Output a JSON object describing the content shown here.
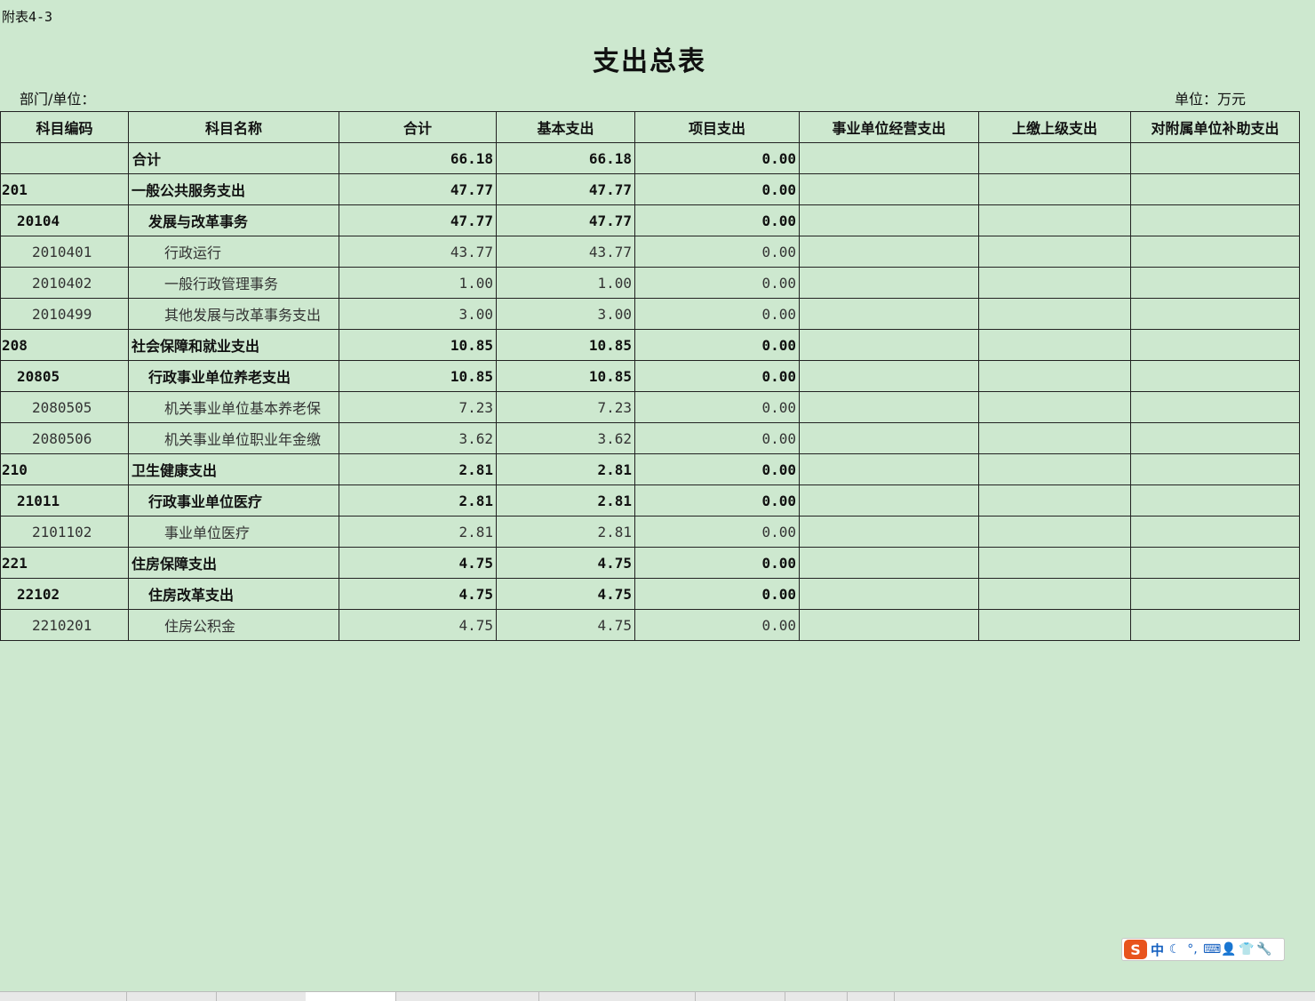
{
  "sheet": {
    "attach_label": "附表4-3",
    "title": "支出总表",
    "dept_label": "部门/单位：",
    "unit_label": "单位：万元"
  },
  "columns": [
    "科目编码",
    "科目名称",
    "合计",
    "基本支出",
    "项目支出",
    "事业单位经营支出",
    "上缴上级支出",
    "对附属单位补助支出"
  ],
  "rows": [
    {
      "code": "",
      "name": "合计",
      "total": "66.18",
      "basic": "66.18",
      "project": "0.00"
    },
    {
      "code": "201",
      "name": "一般公共服务支出",
      "total": "47.77",
      "basic": "47.77",
      "project": "0.00"
    },
    {
      "code": "20104",
      "name": "发展与改革事务",
      "total": "47.77",
      "basic": "47.77",
      "project": "0.00"
    },
    {
      "code": "2010401",
      "name": "行政运行",
      "total": "43.77",
      "basic": "43.77",
      "project": "0.00"
    },
    {
      "code": "2010402",
      "name": "一般行政管理事务",
      "total": "1.00",
      "basic": "1.00",
      "project": "0.00"
    },
    {
      "code": "2010499",
      "name": "其他发展与改革事务支出",
      "total": "3.00",
      "basic": "3.00",
      "project": "0.00"
    },
    {
      "code": "208",
      "name": "社会保障和就业支出",
      "total": "10.85",
      "basic": "10.85",
      "project": "0.00"
    },
    {
      "code": "20805",
      "name": "行政事业单位养老支出",
      "total": "10.85",
      "basic": "10.85",
      "project": "0.00"
    },
    {
      "code": "2080505",
      "name": "机关事业单位基本养老保",
      "total": "7.23",
      "basic": "7.23",
      "project": "0.00"
    },
    {
      "code": "2080506",
      "name": "机关事业单位职业年金缴",
      "total": "3.62",
      "basic": "3.62",
      "project": "0.00"
    },
    {
      "code": "210",
      "name": "卫生健康支出",
      "total": "2.81",
      "basic": "2.81",
      "project": "0.00"
    },
    {
      "code": "21011",
      "name": "行政事业单位医疗",
      "total": "2.81",
      "basic": "2.81",
      "project": "0.00"
    },
    {
      "code": "2101102",
      "name": "事业单位医疗",
      "total": "2.81",
      "basic": "2.81",
      "project": "0.00"
    },
    {
      "code": "221",
      "name": "住房保障支出",
      "total": "4.75",
      "basic": "4.75",
      "project": "0.00"
    },
    {
      "code": "22102",
      "name": "住房改革支出",
      "total": "4.75",
      "basic": "4.75",
      "project": "0.00"
    },
    {
      "code": "2210201",
      "name": "住房公积金",
      "total": "4.75",
      "basic": "4.75",
      "project": "0.00"
    }
  ],
  "ime": {
    "logo": "S",
    "mode": "中",
    "icons": [
      "moon-icon",
      "punctuation-icon",
      "keyboard-icon",
      "user-icon",
      "skin-icon",
      "wrench-icon"
    ]
  }
}
